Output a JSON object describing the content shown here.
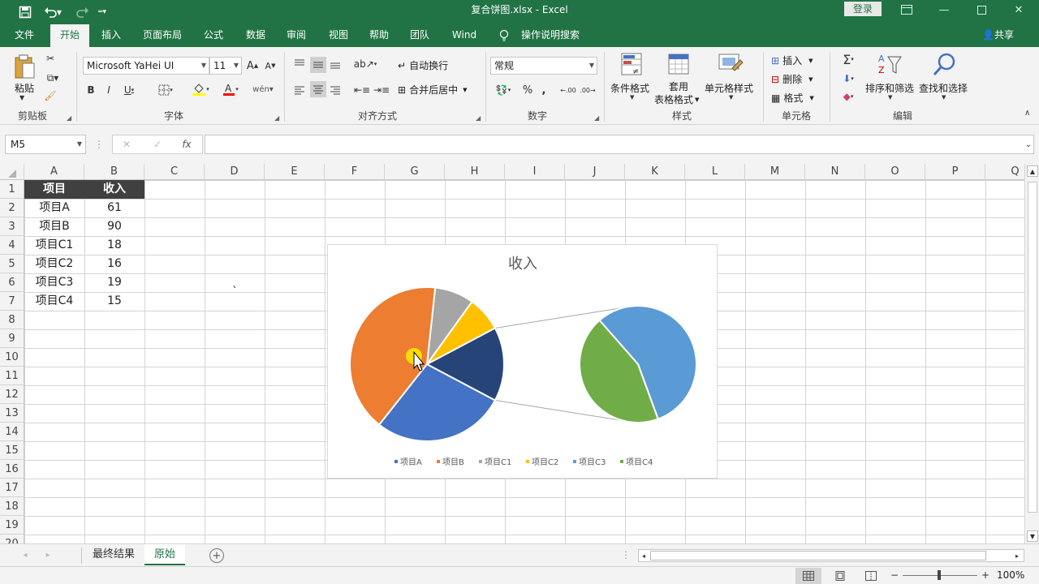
{
  "window": {
    "title": "复合饼图.xlsx  -  Excel",
    "login": "登录",
    "share": "共享"
  },
  "tabs": [
    "文件",
    "开始",
    "插入",
    "页面布局",
    "公式",
    "数据",
    "审阅",
    "视图",
    "帮助",
    "团队",
    "Wind",
    "操作说明搜索"
  ],
  "ribbon": {
    "clipboard": {
      "label": "剪贴板",
      "paste": "粘贴"
    },
    "font": {
      "label": "字体",
      "name": "Microsoft YaHei UI",
      "size": "11"
    },
    "alignment": {
      "label": "对齐方式",
      "wrap": "自动换行",
      "merge": "合并后居中"
    },
    "number": {
      "label": "数字",
      "format": "常规"
    },
    "styles": {
      "label": "样式",
      "conditional": "条件格式",
      "table_line1": "套用",
      "table_line2": "表格格式",
      "cell_styles": "单元格样式"
    },
    "cells": {
      "label": "单元格",
      "insert": "插入",
      "delete": "删除",
      "format": "格式"
    },
    "editing": {
      "label": "编辑",
      "sort": "排序和筛选",
      "find": "查找和选择"
    }
  },
  "formula_bar": {
    "name_box": "M5",
    "fx": "fx",
    "formula": ""
  },
  "columns": [
    "A",
    "B",
    "C",
    "D",
    "E",
    "F",
    "G",
    "H",
    "I",
    "J",
    "K",
    "L",
    "M",
    "N",
    "O",
    "P",
    "Q"
  ],
  "rows": [
    "1",
    "2",
    "3",
    "4",
    "5",
    "6",
    "7",
    "8",
    "9",
    "10",
    "11",
    "12",
    "13",
    "14",
    "15",
    "16",
    "17",
    "18",
    "19",
    "20"
  ],
  "cells": {
    "A1": "项目",
    "B1": "收入",
    "A2": "项目A",
    "B2": "61",
    "A3": "项目B",
    "B3": "90",
    "A4": "项目C1",
    "B4": "18",
    "A5": "项目C2",
    "B5": "16",
    "A6": "项目C3",
    "B6": "19",
    "A7": "项目C4",
    "B7": "15",
    "D6": "`"
  },
  "chart_data": {
    "type": "pie",
    "subtype": "pie-of-pie",
    "title": "收入",
    "categories": [
      "项目A",
      "项目B",
      "项目C1",
      "项目C2",
      "项目C3",
      "项目C4"
    ],
    "values": [
      61,
      90,
      18,
      16,
      19,
      15
    ],
    "colors": [
      "#4472c4",
      "#ed7d31",
      "#a5a5a5",
      "#ffc000",
      "#5b9bd5",
      "#70ad47"
    ],
    "secondary_plot": [
      "项目C3",
      "项目C4"
    ],
    "secondary_combined_color": "#264478",
    "legend_position": "bottom"
  },
  "sheets": {
    "tabs": [
      "最终结果",
      "原始"
    ],
    "active": "原始"
  },
  "status": {
    "zoom": "100%"
  }
}
